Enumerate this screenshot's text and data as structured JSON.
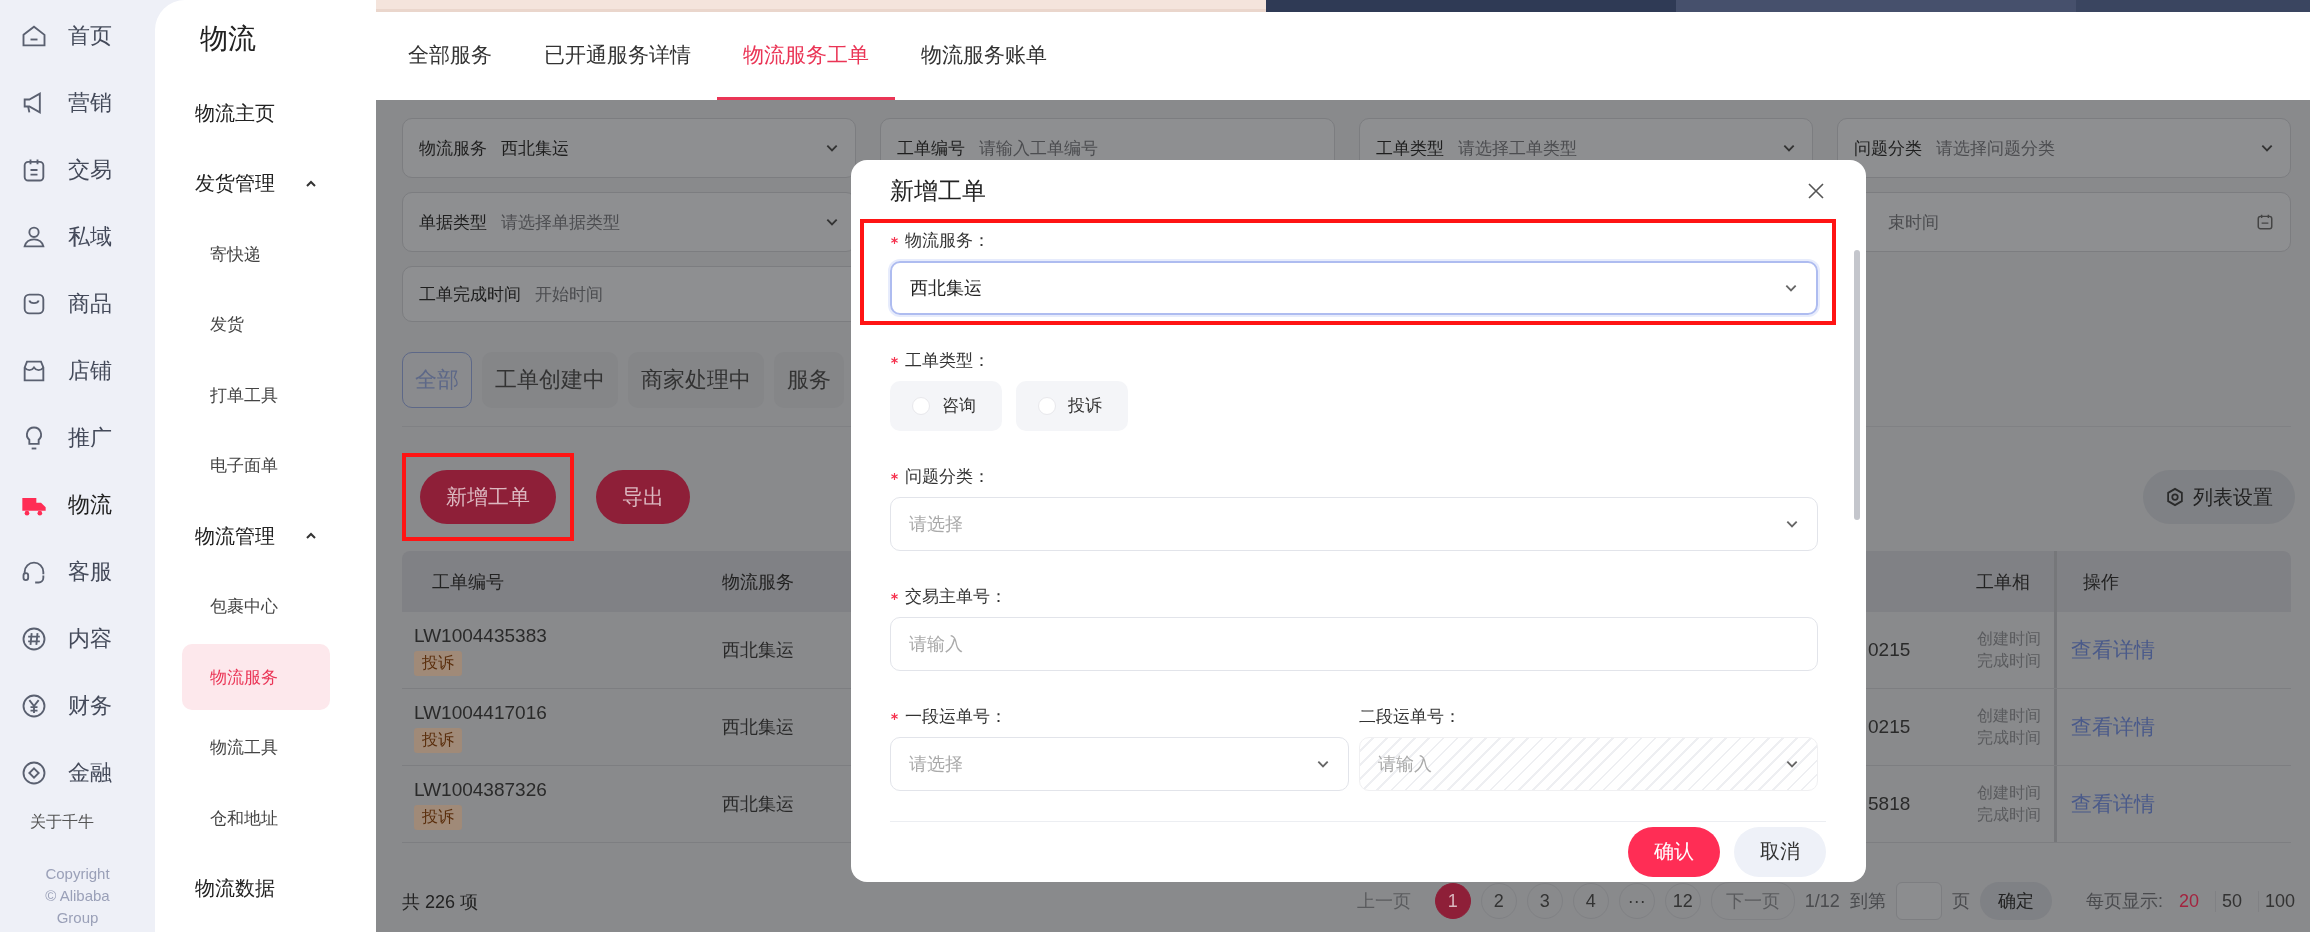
{
  "nav": {
    "items": [
      {
        "label": "首页",
        "selected": false
      },
      {
        "label": "营销",
        "selected": false
      },
      {
        "label": "交易",
        "selected": false
      },
      {
        "label": "私域",
        "selected": false
      },
      {
        "label": "商品",
        "selected": false
      },
      {
        "label": "店铺",
        "selected": false
      },
      {
        "label": "推广",
        "selected": false
      },
      {
        "label": "物流",
        "selected": true
      },
      {
        "label": "客服",
        "selected": false
      },
      {
        "label": "内容",
        "selected": false
      },
      {
        "label": "财务",
        "selected": false
      },
      {
        "label": "金融",
        "selected": false
      }
    ],
    "about": "关于千牛",
    "copyright": [
      "Copyright",
      "© Alibaba Group"
    ]
  },
  "subnav": {
    "title": "物流",
    "items": [
      {
        "kind": "link",
        "label": "物流主页",
        "selected": false
      },
      {
        "kind": "group",
        "label": "发货管理",
        "expanded": true,
        "children": [
          {
            "label": "寄快递",
            "selected": false
          },
          {
            "label": "发货",
            "selected": false
          },
          {
            "label": "打单工具",
            "selected": false
          },
          {
            "label": "电子面单",
            "selected": false
          }
        ]
      },
      {
        "kind": "group",
        "label": "物流管理",
        "expanded": true,
        "children": [
          {
            "label": "包裹中心",
            "selected": false
          },
          {
            "label": "物流服务",
            "selected": true
          },
          {
            "label": "物流工具",
            "selected": false
          },
          {
            "label": "仓和地址",
            "selected": false
          }
        ]
      },
      {
        "kind": "link",
        "label": "物流数据",
        "selected": false
      }
    ]
  },
  "tabs": [
    {
      "label": "全部服务",
      "selected": false
    },
    {
      "label": "已开通服务详情",
      "selected": false
    },
    {
      "label": "物流服务工单",
      "selected": true
    },
    {
      "label": "物流服务账单",
      "selected": false
    }
  ],
  "filter_rows": [
    {
      "items": [
        {
          "kind": "select",
          "label": "物流服务",
          "value": "西北集运"
        },
        {
          "kind": "input",
          "label": "工单编号",
          "placeholder": "请输入工单编号"
        },
        {
          "kind": "select",
          "label": "工单类型",
          "placeholder": "请选择工单类型"
        },
        {
          "kind": "select",
          "label": "问题分类",
          "placeholder": "请选择问题分类"
        }
      ]
    },
    {
      "items": [
        {
          "kind": "select",
          "label": "单据类型",
          "placeholder": "请选择单据类型"
        }
      ],
      "end": [
        {
          "kind": "date",
          "placeholder": "束时间"
        }
      ]
    },
    {
      "items": [
        {
          "kind": "date_range",
          "label": "工单完成时间",
          "placeholder": "开始时间"
        }
      ]
    }
  ],
  "status_chips": [
    {
      "label": "全部",
      "selected": true
    },
    {
      "label": "工单创建中",
      "selected": false
    },
    {
      "label": "商家处理中",
      "selected": false
    },
    {
      "label": "服务",
      "selected": false
    }
  ],
  "toolbar": {
    "buttons": [
      {
        "label": "新增工单",
        "highlighted": true
      },
      {
        "label": "导出",
        "highlighted": false
      }
    ],
    "settings": "列表设置"
  },
  "table": {
    "columns": [
      "工单编号",
      "物流服务"
    ],
    "fixed_columns": [
      "工单相",
      "操作"
    ],
    "rows": [
      {
        "id": "LW1004435383",
        "tag": "投诉",
        "service": "西北集运",
        "column_3": "0215",
        "times": [
          "创建时间",
          "完成时间"
        ],
        "action": "查看详情"
      },
      {
        "id": "LW1004417016",
        "tag": "投诉",
        "service": "西北集运",
        "column_3": "0215",
        "times": [
          "创建时间",
          "完成时间"
        ],
        "action": "查看详情"
      },
      {
        "id": "LW1004387326",
        "tag": "投诉",
        "service": "西北集运",
        "column_3": "5818",
        "times": [
          "创建时间",
          "完成时间"
        ],
        "action": "查看详情"
      }
    ]
  },
  "pagination": {
    "total": "共 226 项",
    "prev": "上一页",
    "pages": [
      {
        "label": "1",
        "selected": true
      },
      {
        "label": "2",
        "selected": false
      },
      {
        "label": "3",
        "selected": false
      },
      {
        "label": "4",
        "selected": false
      },
      {
        "label": "···",
        "selected": false
      },
      {
        "label": "12",
        "selected": false
      }
    ],
    "next": "下一页",
    "page_count": "1/12",
    "goto_before": "到第",
    "goto_after": "页",
    "confirm": "确定",
    "page_size_label": "每页显示:",
    "sizes": [
      {
        "label": "20",
        "selected": true
      },
      {
        "label": "50",
        "selected": false
      },
      {
        "label": "100",
        "selected": false
      }
    ]
  },
  "modal": {
    "title": "新增工单",
    "fields": [
      {
        "kind": "select",
        "label": "物流服务：",
        "required": true,
        "value": "西北集运",
        "focused": true,
        "highlighted": true
      },
      {
        "kind": "radio",
        "label": "工单类型：",
        "required": true,
        "options": [
          {
            "label": "咨询",
            "selected": false
          },
          {
            "label": "投诉",
            "selected": false
          }
        ]
      },
      {
        "kind": "select",
        "label": "问题分类：",
        "required": true,
        "placeholder": "请选择"
      },
      {
        "kind": "input",
        "label": "交易主单号：",
        "required": true,
        "placeholder": "请输入"
      },
      {
        "kind": "pair",
        "fields": [
          {
            "kind": "select",
            "label": "一段运单号：",
            "required": true,
            "placeholder": "请选择"
          },
          {
            "kind": "select",
            "label": "二段运单号：",
            "required": false,
            "placeholder": "请输入",
            "disabled": true
          }
        ]
      }
    ],
    "buttons": [
      {
        "label": "确认",
        "primary": true
      },
      {
        "label": "取消",
        "primary": false
      }
    ]
  }
}
